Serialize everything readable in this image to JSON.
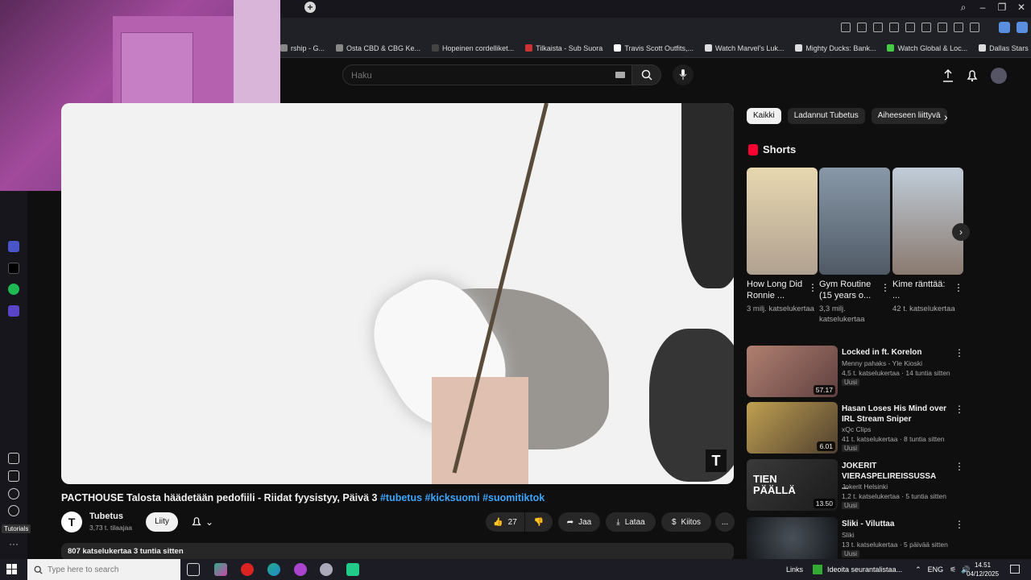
{
  "browser": {
    "bookmarks": [
      {
        "label": "rship - G...",
        "color": "#888"
      },
      {
        "label": "Osta CBD & CBG Ke...",
        "color": "#888"
      },
      {
        "label": "Hopeinen cordelliket...",
        "color": "#444"
      },
      {
        "label": "Tilkaista - Sub Suora",
        "color": "#c33"
      },
      {
        "label": "Travis Scott Outfits,...",
        "color": "#fff"
      },
      {
        "label": "Watch Marvel's Luk...",
        "color": "#ddd"
      },
      {
        "label": "Mighty Ducks: Bank...",
        "color": "#ddd"
      },
      {
        "label": "Watch Global & Loc...",
        "color": "#4c4"
      },
      {
        "label": "Dallas Stars Fanatics...",
        "color": "#ddd"
      }
    ]
  },
  "masthead": {
    "search_placeholder": "Haku"
  },
  "video": {
    "title": "PACTHOUSE Talosta häädetään pedofiili - Riidat fyysistyy, Päivä 3",
    "hashtags": [
      "#tubetus",
      "#kicksuomi",
      "#suomitiktok"
    ],
    "channel_name": "Tubetus",
    "subscribers": "3,73 t. tilaajaa",
    "join_label": "Liity",
    "likes": "27",
    "share_label": "Jaa",
    "download_label": "Lataa",
    "thanks_label": "Kiitos",
    "more_label": "...",
    "views_time": "807 katselukertaa  3 tuntia sitten",
    "watermark": "T"
  },
  "chips": [
    "Kaikki",
    "Ladannut Tubetus",
    "Aiheeseen liittyvä"
  ],
  "shorts": {
    "header": "Shorts",
    "items": [
      {
        "title": "How Long Did Ronnie ...",
        "views": "3 milj. katselukertaa",
        "thumb": "#c9b8a0"
      },
      {
        "title": "Gym Routine (15 years o...",
        "views": "3,3 milj. katselukertaa",
        "thumb": "#6a7a8a"
      },
      {
        "title": "Kime ränttää: ...",
        "views": "42 t. katselukertaa",
        "thumb": "#9aa8b4"
      }
    ]
  },
  "recommendations": [
    {
      "title": "Locked in ft. Korelon",
      "channel": "Menny pahaks - Yle Kioski",
      "meta": "4,5 t. katselukertaa · 14 tuntia sitten",
      "badge": "Uusi",
      "duration": "57.17",
      "thumb": "#7a5a50"
    },
    {
      "title": "Hasan Loses His Mind over IRL Stream Sniper",
      "channel": "xQc Clips",
      "meta": "41 t. katselukertaa · 8 tuntia sitten",
      "badge": "Uusi",
      "duration": "6.01",
      "thumb": "#8a7040"
    },
    {
      "title": "JOKERIT VIERASPELIREISSUSSA ...",
      "channel": "Jokerit Helsinki",
      "meta": "1,2 t. katselukertaa · 5 tuntia sitten",
      "badge": "Uusi",
      "duration": "13.50",
      "thumb": "#2a2a2a",
      "overlay": "TIEN PÄÄLLÄ"
    },
    {
      "title": "Sliki - Viluttaa",
      "channel": "Sliki",
      "meta": "13 t. katselukertaa · 5 päivää sitten",
      "badge": "Uusi",
      "duration": "",
      "thumb": "#1a1e24"
    }
  ],
  "sidebar": {
    "tutorials_label": "Tutorials"
  },
  "taskbar": {
    "search_placeholder": "Type here to search",
    "links_label": "Links",
    "notification": "Ideoita seurantalistaa...",
    "lang": "ENG",
    "time": "14.51",
    "date": "04/12/2025"
  }
}
